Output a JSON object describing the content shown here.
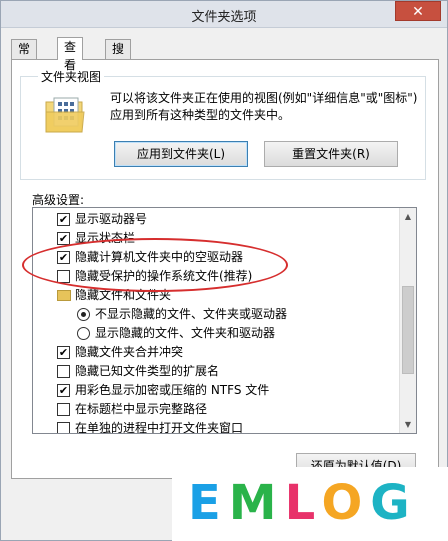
{
  "window": {
    "title": "文件夹选项",
    "close_glyph": "✕"
  },
  "tabs": [
    {
      "label": "常规"
    },
    {
      "label": "查看"
    },
    {
      "label": "搜索"
    }
  ],
  "folder_view": {
    "title": "文件夹视图",
    "description": "可以将该文件夹正在使用的视图(例如\"详细信息\"或\"图标\")应用到所有这种类型的文件夹中。",
    "apply_button": "应用到文件夹(L)",
    "reset_button": "重置文件夹(R)"
  },
  "advanced": {
    "label": "高级设置:",
    "items": [
      {
        "type": "checkbox",
        "checked": true,
        "label": "显示驱动器号"
      },
      {
        "type": "checkbox",
        "checked": true,
        "label": "显示状态栏"
      },
      {
        "type": "checkbox",
        "checked": true,
        "label": "隐藏计算机文件夹中的空驱动器"
      },
      {
        "type": "checkbox",
        "checked": false,
        "label": "隐藏受保护的操作系统文件(推荐)"
      },
      {
        "type": "folder",
        "label": "隐藏文件和文件夹"
      },
      {
        "type": "radio",
        "checked": true,
        "label": "不显示隐藏的文件、文件夹或驱动器"
      },
      {
        "type": "radio",
        "checked": false,
        "label": "显示隐藏的文件、文件夹和驱动器"
      },
      {
        "type": "checkbox",
        "checked": true,
        "label": "隐藏文件夹合并冲突"
      },
      {
        "type": "checkbox",
        "checked": false,
        "label": "隐藏已知文件类型的扩展名"
      },
      {
        "type": "checkbox",
        "checked": true,
        "label": "用彩色显示加密或压缩的 NTFS 文件"
      },
      {
        "type": "checkbox",
        "checked": false,
        "label": "在标题栏中显示完整路径"
      },
      {
        "type": "checkbox",
        "checked": false,
        "label": "在单独的进程中打开文件夹窗口"
      }
    ],
    "check_glyph": "✔",
    "restore_button": "还原为默认值(D)"
  },
  "watermark": {
    "text": "EMLOG",
    "colors": [
      "#1aa0e6",
      "#2ab34a",
      "#e8326a",
      "#f5a623",
      "#1db3c4"
    ]
  }
}
